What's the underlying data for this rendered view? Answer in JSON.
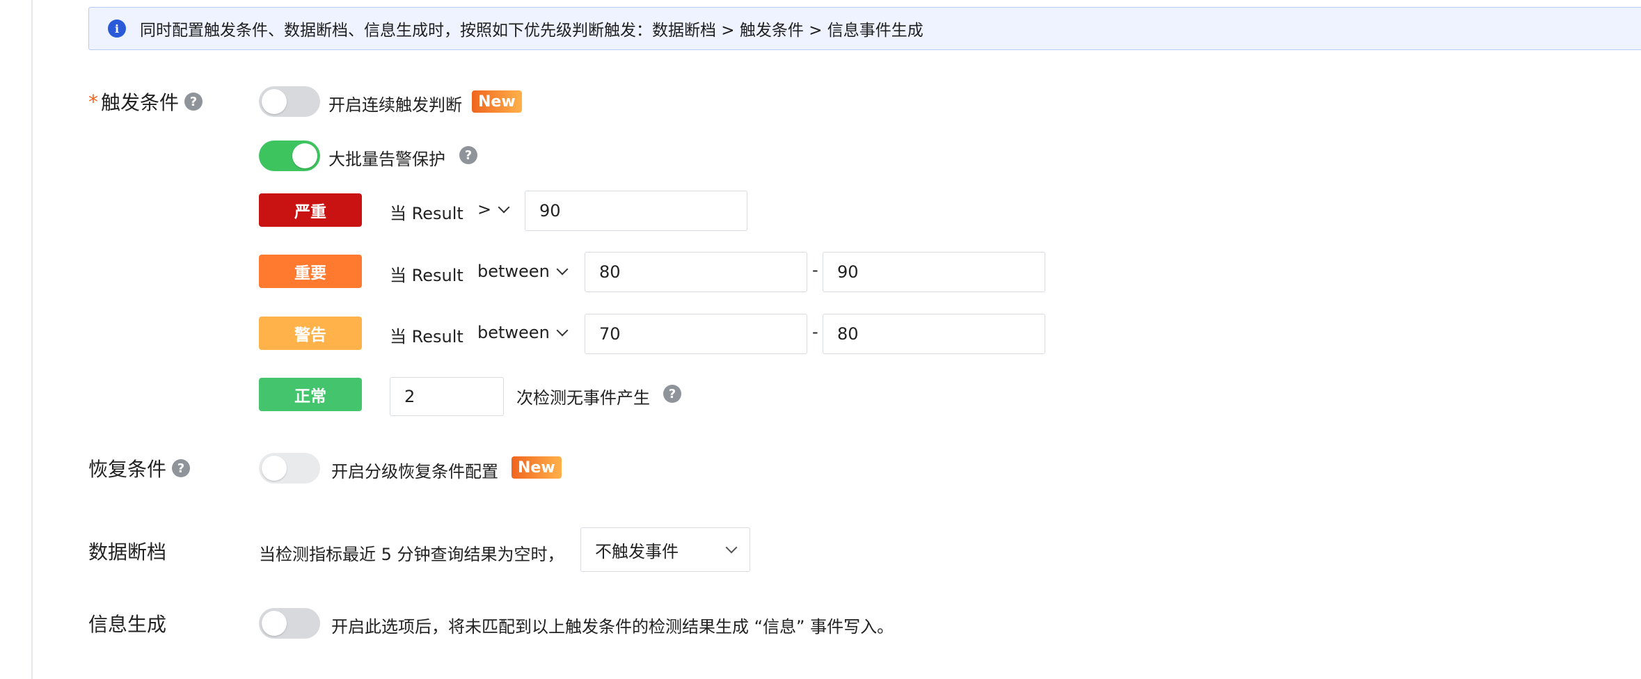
{
  "banner": {
    "icon": "info-icon",
    "text": "同时配置触发条件、数据断档、信息生成时，按照如下优先级判断触发：数据断档 > 触发条件 > 信息事件生成"
  },
  "trigger": {
    "label": "触发条件",
    "required_mark": "*",
    "help": "?",
    "continuous": {
      "label": "开启连续触发判断",
      "badge": "New",
      "enabled": false
    },
    "bulk_protection": {
      "label": "大批量告警保护",
      "help": "?",
      "enabled": true
    },
    "rules": [
      {
        "level": "严重",
        "prefix": "当 Result",
        "operator": ">",
        "value": "90",
        "color": "#c91212"
      },
      {
        "level": "重要",
        "prefix": "当 Result",
        "operator": "between",
        "min": "80",
        "separator": "-",
        "max": "90",
        "color": "#ff7a2f"
      },
      {
        "level": "警告",
        "prefix": "当 Result",
        "operator": "between",
        "min": "70",
        "separator": "-",
        "max": "80",
        "color": "#ffb24a"
      }
    ],
    "normal": {
      "level": "正常",
      "count": "2",
      "suffix": "次检测无事件产生",
      "help": "?",
      "color": "#44c46c"
    }
  },
  "recovery": {
    "label": "恢复条件",
    "help": "?",
    "toggle_label": "开启分级恢复条件配置",
    "badge": "New",
    "enabled": false
  },
  "data_gap": {
    "label": "数据断档",
    "text": "当检测指标最近 5 分钟查询结果为空时，",
    "select_value": "不触发事件"
  },
  "info_gen": {
    "label": "信息生成",
    "text": "开启此选项后，将未匹配到以上触发条件的检测结果生成 “信息” 事件写入。",
    "enabled": false
  }
}
